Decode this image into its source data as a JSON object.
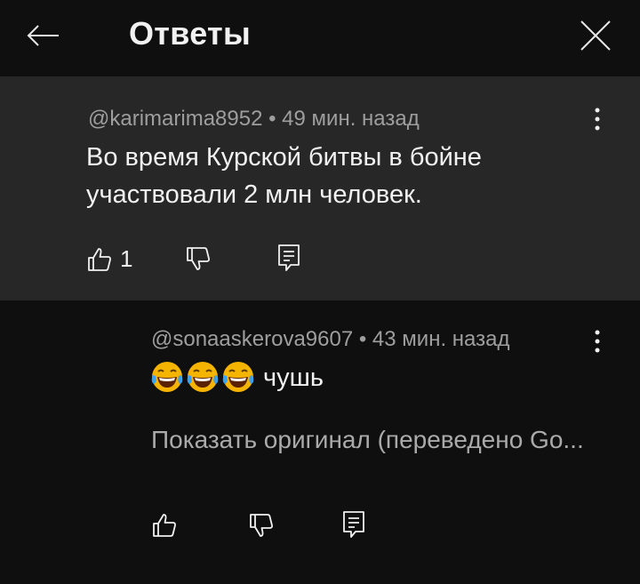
{
  "header": {
    "title": "Ответы"
  },
  "parent_comment": {
    "author": "@karimarima8952",
    "time": "• 49 мин. назад",
    "text_line1": "Во время Курской битвы в бойне",
    "text_line2": "участвовали 2 млн человек.",
    "likes": "1"
  },
  "reply": {
    "author": "@sonaaskerova9607",
    "time": "• 43 мин. назад",
    "emoji": "face-with-tears-of-joy ×3",
    "text": "чушь",
    "translate_link": "Показать оригинал (переведено Go..."
  },
  "icons": {
    "back": "arrow-left-icon",
    "close": "close-icon",
    "more": "more-vertical-icon",
    "like": "thumb-up-icon",
    "dislike": "thumb-down-icon",
    "reply": "reply-icon"
  },
  "colors": {
    "background": "#0f0f0f",
    "highlight": "#272727",
    "secondary_text": "#9e9e9e",
    "emoji": "#f5b400"
  }
}
